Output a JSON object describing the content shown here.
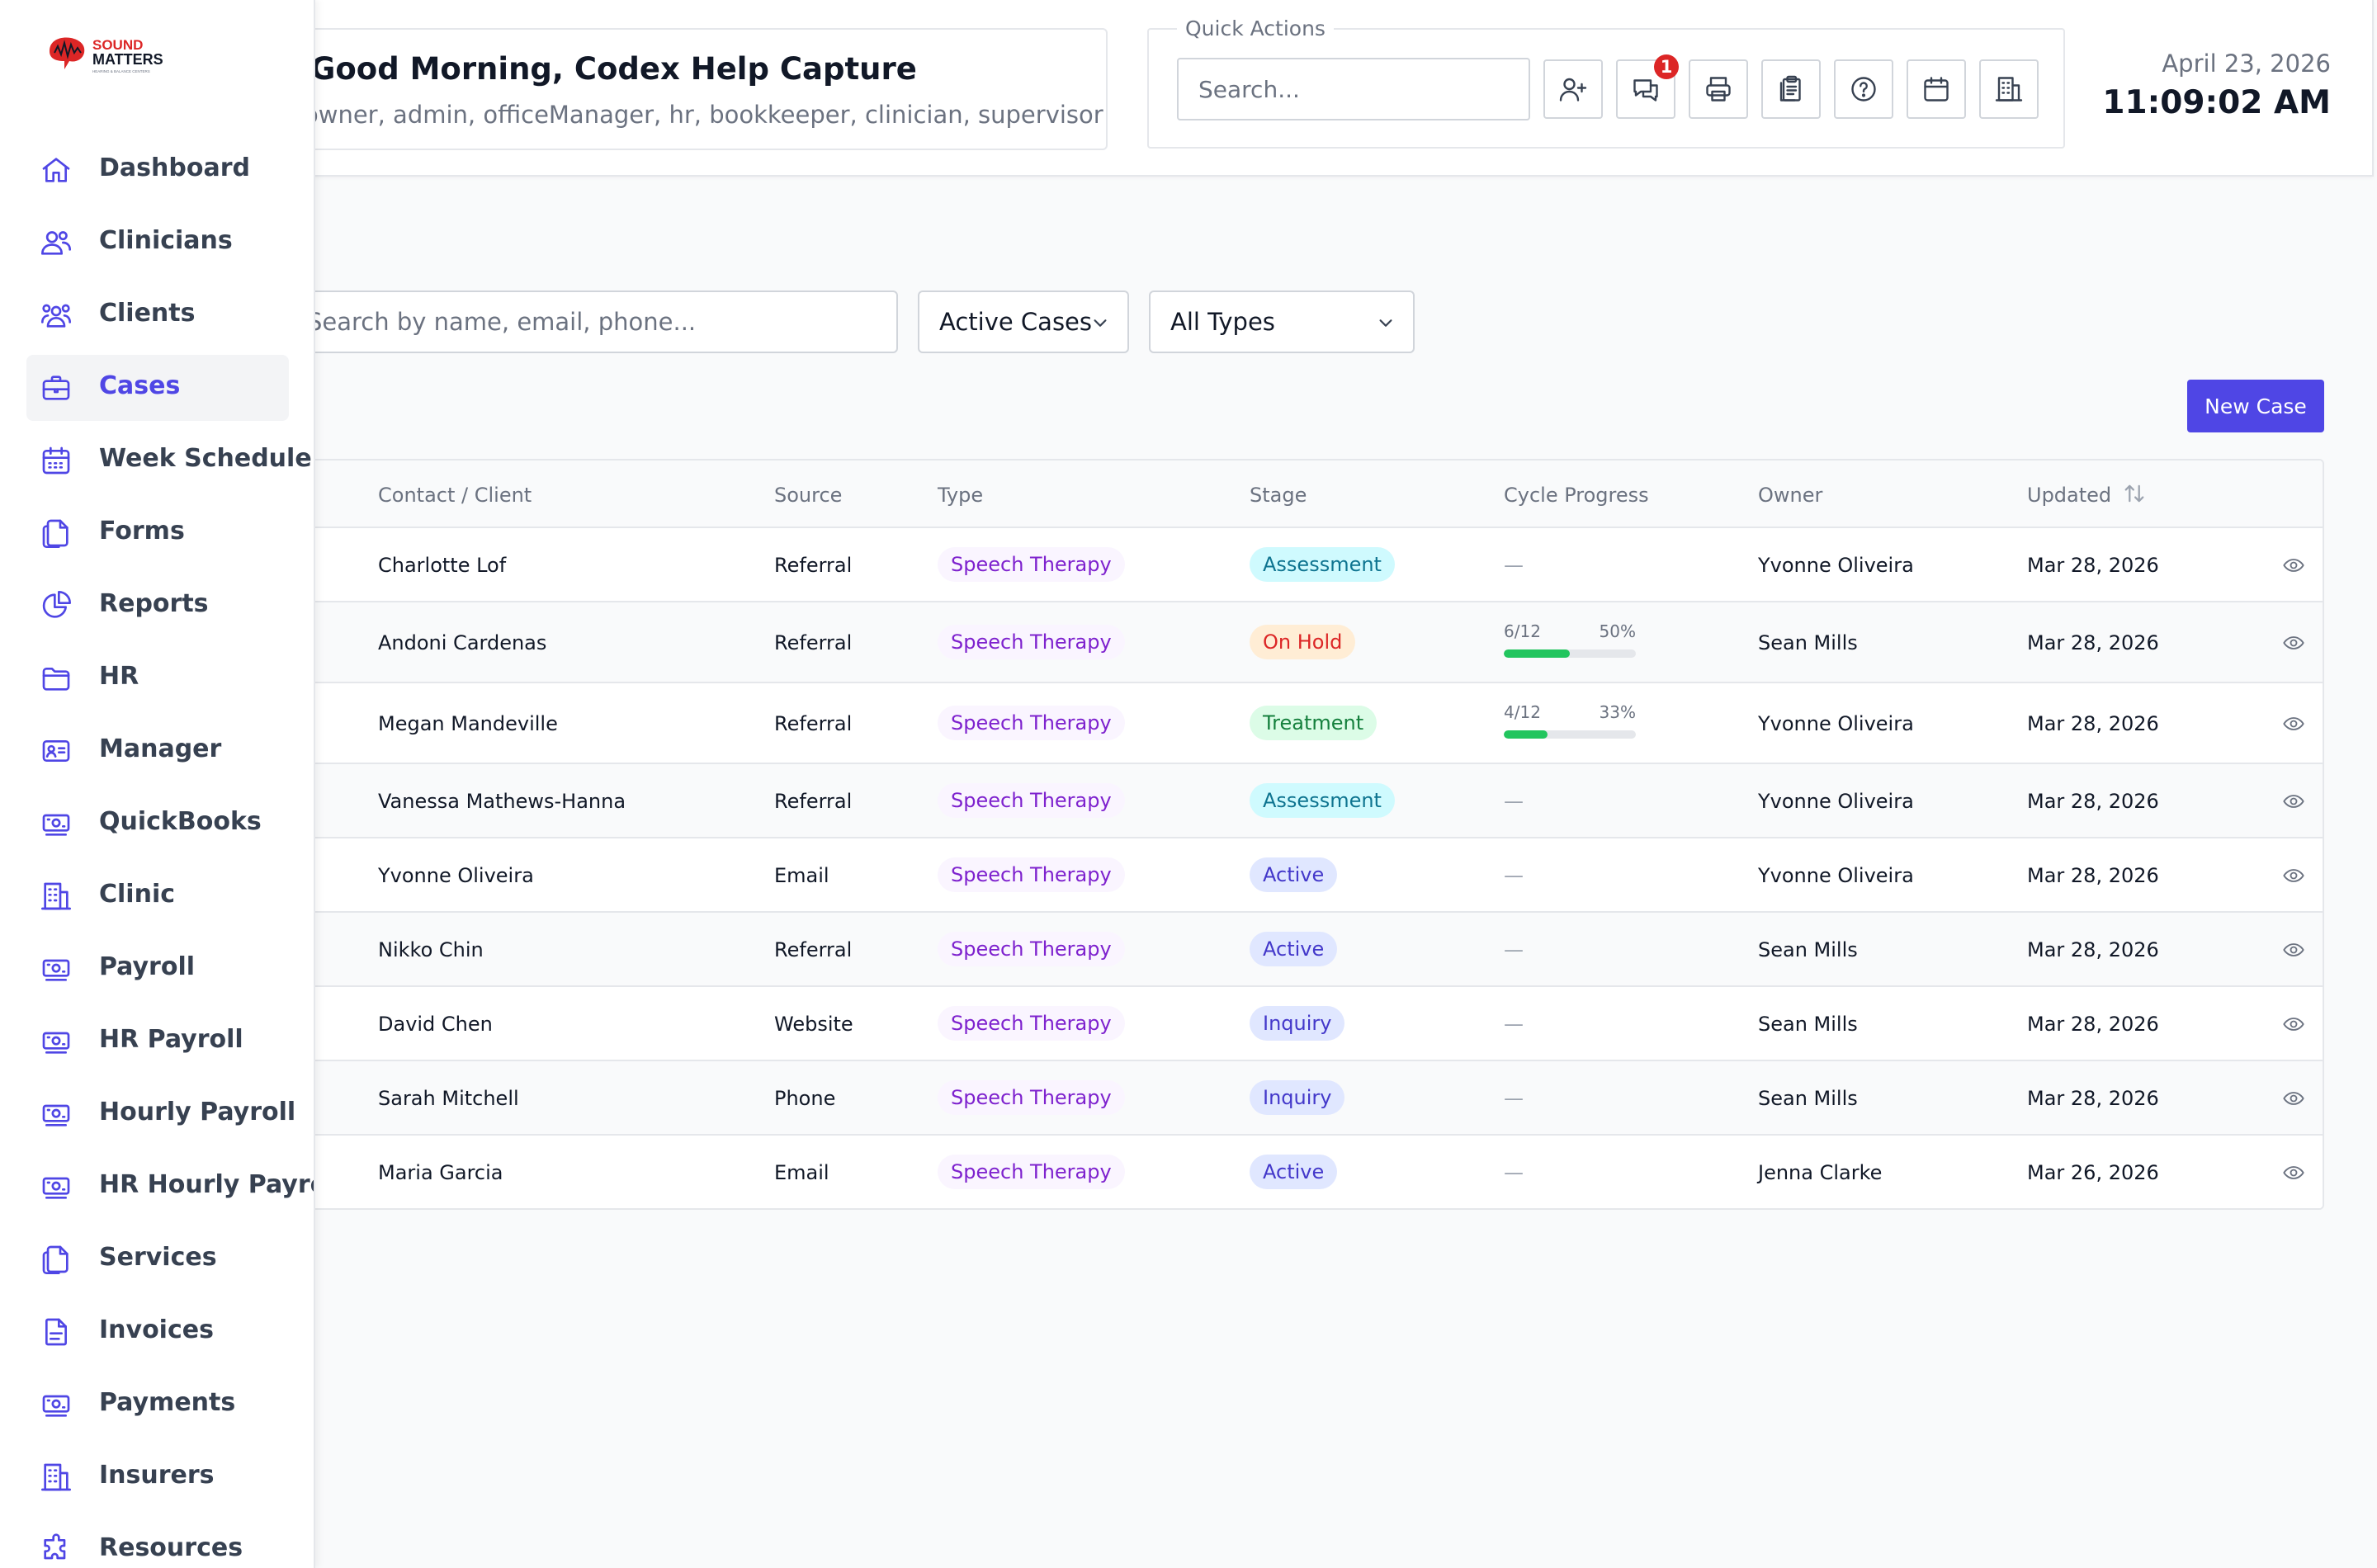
{
  "header": {
    "greeting": "Good Morning, Codex Help Capture",
    "roles": "owner, admin, officeManager, hr, bookkeeper, clinician, supervisor",
    "quick_actions_label": "Quick Actions",
    "search_placeholder": "Search...",
    "chat_badge": "1",
    "date": "April 23, 2026",
    "time": "11:09:02 AM",
    "quick_action_icons": [
      "add-user-icon",
      "chat-icon",
      "printer-icon",
      "clipboard-icon",
      "help-icon",
      "calendar-icon",
      "building-icon"
    ]
  },
  "logo": {
    "line1": "SOUND",
    "line2": "MATTERS",
    "tagline": "HEARING & BALANCE CENTERS"
  },
  "sidebar": {
    "items": [
      {
        "label": "Dashboard",
        "icon": "home-icon"
      },
      {
        "label": "Clinicians",
        "icon": "users-icon"
      },
      {
        "label": "Clients",
        "icon": "user-group-icon"
      },
      {
        "label": "Cases",
        "icon": "briefcase-icon",
        "active": true
      },
      {
        "label": "Week Schedule",
        "icon": "calendar-icon"
      },
      {
        "label": "Forms",
        "icon": "documents-icon"
      },
      {
        "label": "Reports",
        "icon": "pie-chart-icon"
      },
      {
        "label": "HR",
        "icon": "folder-icon"
      },
      {
        "label": "Manager",
        "icon": "id-card-icon"
      },
      {
        "label": "QuickBooks",
        "icon": "cash-icon"
      },
      {
        "label": "Clinic",
        "icon": "building-icon"
      },
      {
        "label": "Payroll",
        "icon": "cash-icon"
      },
      {
        "label": "HR Payroll",
        "icon": "cash-icon"
      },
      {
        "label": "Hourly Payroll",
        "icon": "cash-icon"
      },
      {
        "label": "HR Hourly Payroll",
        "icon": "cash-icon"
      },
      {
        "label": "Services",
        "icon": "documents-icon"
      },
      {
        "label": "Invoices",
        "icon": "document-text-icon"
      },
      {
        "label": "Payments",
        "icon": "cash-icon"
      },
      {
        "label": "Insurers",
        "icon": "building-icon"
      },
      {
        "label": "Resources",
        "icon": "puzzle-icon"
      }
    ]
  },
  "filters": {
    "search_placeholder": "Search by name, email, phone...",
    "status_value": "Active Cases",
    "type_value": "All Types"
  },
  "actions": {
    "new_case": "New Case"
  },
  "table": {
    "columns": [
      "Contact / Client",
      "Source",
      "Type",
      "Stage",
      "Cycle Progress",
      "Owner",
      "Updated"
    ],
    "stage_colors": {
      "Assessment": {
        "bg": "#cffafe",
        "fg": "#0e7490"
      },
      "On Hold": {
        "bg": "#ffedd5",
        "fg": "#dc2626"
      },
      "Treatment": {
        "bg": "#dcfce7",
        "fg": "#15803d"
      },
      "Active": {
        "bg": "#e0e7ff",
        "fg": "#4338ca"
      },
      "Inquiry": {
        "bg": "#e0e7ff",
        "fg": "#4338ca"
      }
    },
    "empty_progress": "—",
    "rows": [
      {
        "client": "Charlotte Lof",
        "source": "Referral",
        "type": "Speech Therapy",
        "stage": "Assessment",
        "progress": null,
        "owner": "Yvonne Oliveira",
        "updated": "Mar 28, 2026"
      },
      {
        "client": "Andoni Cardenas",
        "source": "Referral",
        "type": "Speech Therapy",
        "stage": "On Hold",
        "progress": {
          "label": "6/12",
          "pct_label": "50%",
          "fraction": 0.5
        },
        "owner": "Sean Mills",
        "updated": "Mar 28, 2026"
      },
      {
        "client": "Megan Mandeville",
        "source": "Referral",
        "type": "Speech Therapy",
        "stage": "Treatment",
        "progress": {
          "label": "4/12",
          "pct_label": "33%",
          "fraction": 0.33
        },
        "owner": "Yvonne Oliveira",
        "updated": "Mar 28, 2026"
      },
      {
        "client": "Vanessa Mathews-Hanna",
        "source": "Referral",
        "type": "Speech Therapy",
        "stage": "Assessment",
        "progress": null,
        "owner": "Yvonne Oliveira",
        "updated": "Mar 28, 2026"
      },
      {
        "client": "Yvonne Oliveira",
        "source": "Email",
        "type": "Speech Therapy",
        "stage": "Active",
        "progress": null,
        "owner": "Yvonne Oliveira",
        "updated": "Mar 28, 2026"
      },
      {
        "client": "Nikko Chin",
        "source": "Referral",
        "type": "Speech Therapy",
        "stage": "Active",
        "progress": null,
        "owner": "Sean Mills",
        "updated": "Mar 28, 2026"
      },
      {
        "client": "David Chen",
        "source": "Website",
        "type": "Speech Therapy",
        "stage": "Inquiry",
        "progress": null,
        "owner": "Sean Mills",
        "updated": "Mar 28, 2026"
      },
      {
        "client": "Sarah Mitchell",
        "source": "Phone",
        "type": "Speech Therapy",
        "stage": "Inquiry",
        "progress": null,
        "owner": "Sean Mills",
        "updated": "Mar 28, 2026"
      },
      {
        "client": "Maria Garcia",
        "source": "Email",
        "type": "Speech Therapy",
        "stage": "Active",
        "progress": null,
        "owner": "Jenna Clarke",
        "updated": "Mar 26, 2026"
      }
    ]
  },
  "colors": {
    "accent": "#4f46e5",
    "progress": "#22c55e",
    "badge": "#dc2626",
    "logo_red": "#dc2626"
  }
}
